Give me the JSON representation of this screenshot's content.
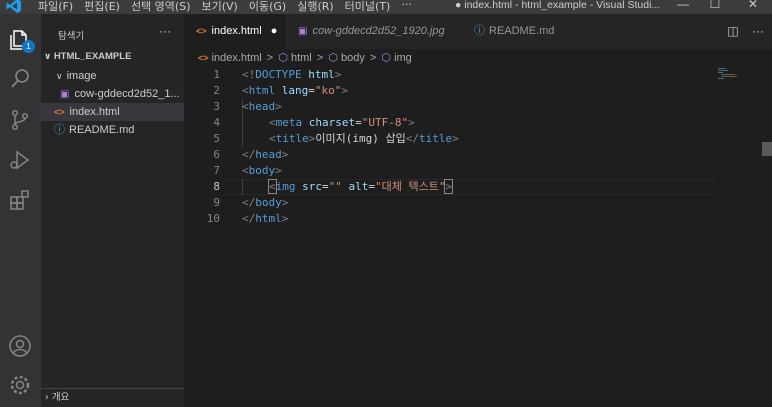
{
  "menu": [
    "파일(F)",
    "편집(E)",
    "선택 영역(S)",
    "보기(V)",
    "이동(G)",
    "실행(R)",
    "터미널(T)",
    "···"
  ],
  "window_title": "● index.html - html_example - Visual Studi...",
  "window_controls": {
    "minimize": "—",
    "maximize": "☐",
    "close": "✕"
  },
  "activity": {
    "explorer_badge": "1"
  },
  "sidebar": {
    "title": "탐색기",
    "more": "···",
    "root": "HTML_EXAMPLE",
    "items": [
      {
        "chevron": "∨",
        "label": "image"
      },
      {
        "icon": "▣",
        "label": "cow-gddecd2d52_1..."
      },
      {
        "icon": "<>",
        "label": "index.html"
      },
      {
        "icon": "ⓘ",
        "label": "README.md"
      }
    ],
    "outline": "› 개요"
  },
  "tabs": [
    {
      "icon": "<>",
      "label": "index.html",
      "dirty": "●"
    },
    {
      "icon": "▣",
      "label": "cow-gddecd2d52_1920.jpg"
    },
    {
      "icon": "ⓘ",
      "label": "README.md"
    }
  ],
  "tab_actions": {
    "split": "◫",
    "more": "···"
  },
  "breadcrumb": [
    "index.html",
    "html",
    "body",
    "img"
  ],
  "breadcrumb_sep": ">",
  "editor": {
    "line_numbers": [
      "1",
      "2",
      "3",
      "4",
      "5",
      "6",
      "7",
      "8",
      "9",
      "10"
    ],
    "current_line": "8",
    "lines": [
      {
        "p1": "<!",
        "t1": "DOCTYPE ",
        "a1": "html",
        "p2": ">"
      },
      {
        "p1": "<",
        "t1": "html ",
        "a1": "lang",
        "eq": "=",
        "s1": "\"ko\"",
        "p2": ">"
      },
      {
        "p1": "<",
        "t1": "head",
        "p2": ">"
      },
      {
        "p1": "<",
        "t1": "meta ",
        "a1": "charset",
        "eq": "=",
        "s1": "\"UTF-8\"",
        "p2": ">"
      },
      {
        "p1": "<",
        "t1": "title",
        "p2": ">",
        "txt": "이미지(img) 삽입",
        "p3": "</",
        "t2": "title",
        "p4": ">"
      },
      {
        "p1": "</",
        "t1": "head",
        "p2": ">"
      },
      {
        "p1": "<",
        "t1": "body",
        "p2": ">"
      },
      {
        "p1": "<",
        "t1": "img ",
        "a1": "src",
        "eq": "=",
        "s1": "\"\" ",
        "a2": "alt",
        "eq2": "=",
        "s2": "\"대체 텍스트\"",
        "p2": ">"
      },
      {
        "p1": "</",
        "t1": "body",
        "p2": ">"
      },
      {
        "p1": "</",
        "t1": "html",
        "p2": ">"
      }
    ]
  }
}
